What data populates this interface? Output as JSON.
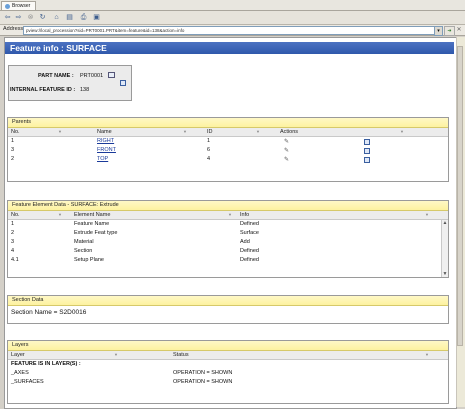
{
  "browser": {
    "tab_label": "Browser",
    "address_label": "Address",
    "url": "pview://local_procession?sid=PRT0001.PRT&item=feature&id=138&action=info"
  },
  "header": {
    "title": "Feature info : SURFACE"
  },
  "info": {
    "part_name_label": "PART NAME :",
    "part_name": "PRT0001",
    "feature_id_label": "INTERNAL FEATURE ID :",
    "feature_id": "138"
  },
  "parents": {
    "title": "Parents",
    "columns": [
      "No.",
      "Name",
      "ID",
      "Actions"
    ],
    "rows": [
      {
        "no": "1",
        "name": "RIGHT",
        "id": "1"
      },
      {
        "no": "3",
        "name": "FRONT",
        "id": "6"
      },
      {
        "no": "2",
        "name": "TOP",
        "id": "4"
      }
    ]
  },
  "elements": {
    "title": "Feature Element Data - SURFACE: Extrude",
    "columns": [
      "No.",
      "Element Name",
      "Info"
    ],
    "rows": [
      {
        "no": "1",
        "name": "Feature Name",
        "info": "Defined"
      },
      {
        "no": "2",
        "name": "Extrude Feat type",
        "info": "Surface"
      },
      {
        "no": "3",
        "name": "Material",
        "info": "Add"
      },
      {
        "no": "4",
        "name": "Section",
        "info": "Defined"
      },
      {
        "no": "4.1",
        "name": "Setup Plane",
        "info": "Defined"
      }
    ]
  },
  "section": {
    "title": "Section Data",
    "text": "Section Name = S2D0016"
  },
  "layers": {
    "title": "Layers",
    "columns": [
      "Layer",
      "Status"
    ],
    "heading": "FEATURE IS IN LAYER(S) :",
    "rows": [
      {
        "layer": "_AXES",
        "status": "OPERATION = SHOWN"
      },
      {
        "layer": "_SURFACES",
        "status": "OPERATION = SHOWN"
      }
    ]
  }
}
